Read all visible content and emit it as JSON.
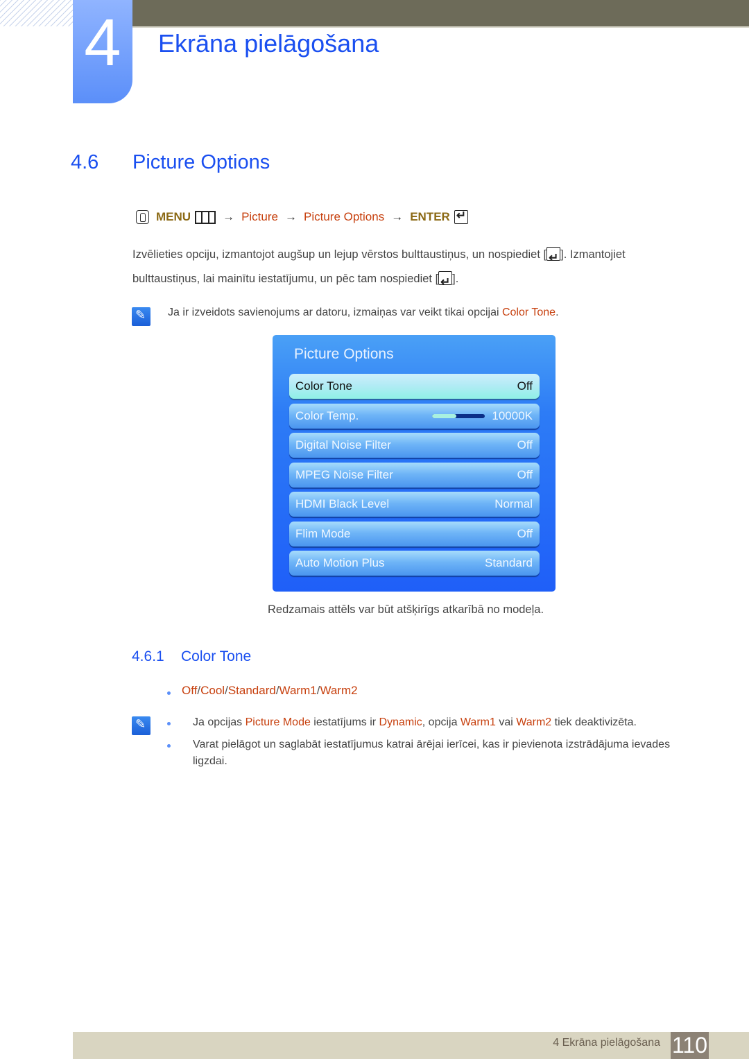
{
  "chapter": {
    "number": "4",
    "title": "Ekrāna pielāgošana"
  },
  "section": {
    "number": "4.6",
    "title": "Picture Options"
  },
  "menu_path": {
    "menu_label": "MENU",
    "steps": [
      "Picture",
      "Picture Options"
    ],
    "enter_label": "ENTER",
    "arrow": "→"
  },
  "intro": {
    "line1_a": "Izvēlieties opciju, izmantojot augšup un lejup vērstos bulttaustiņus, un nospiediet [",
    "line1_b": "]. Izmantojiet",
    "line2_a": "bulttaustiņus, lai mainītu iestatījumu, un pēc tam nospiediet [",
    "line2_b": "]."
  },
  "note1": {
    "text": "Ja ir izveidots savienojums ar datoru, izmaiņas var veikt tikai opcijai ",
    "highlight": "Color Tone",
    "end": "."
  },
  "osd": {
    "title": "Picture Options",
    "rows": [
      {
        "label": "Color Tone",
        "value": "Off",
        "selected": true
      },
      {
        "label": "Color Temp.",
        "value": "10000K",
        "slider_fraction": 0.45
      },
      {
        "label": "Digital Noise Filter",
        "value": "Off"
      },
      {
        "label": "MPEG Noise Filter",
        "value": "Off"
      },
      {
        "label": "HDMI Black Level",
        "value": "Normal"
      },
      {
        "label": "Flim Mode",
        "value": "Off"
      },
      {
        "label": "Auto Motion Plus",
        "value": "Standard"
      }
    ]
  },
  "caption": "Redzamais attēls var būt atšķirīgs atkarībā no modeļa.",
  "subsection": {
    "number": "4.6.1",
    "title": "Color Tone"
  },
  "options": [
    "Off",
    "Cool",
    "Standard",
    "Warm1",
    "Warm2"
  ],
  "options_separator": "/",
  "note2": {
    "item1": {
      "a": "Ja opcijas ",
      "b": "Picture Mode",
      "c": " iestatījums ir ",
      "d": "Dynamic",
      "e": ", opcija ",
      "f": "Warm1",
      "g": " vai ",
      "h": "Warm2",
      "i": " tiek deaktivizēta."
    },
    "item2_line1": "Varat pielāgot un saglabāt iestatījumus katrai ārējai ierīcei, kas ir pievienota izstrādājuma ievades",
    "item2_line2": "ligzdai."
  },
  "footer": {
    "label": "4 Ekrāna pielāgošana",
    "page": "110"
  }
}
